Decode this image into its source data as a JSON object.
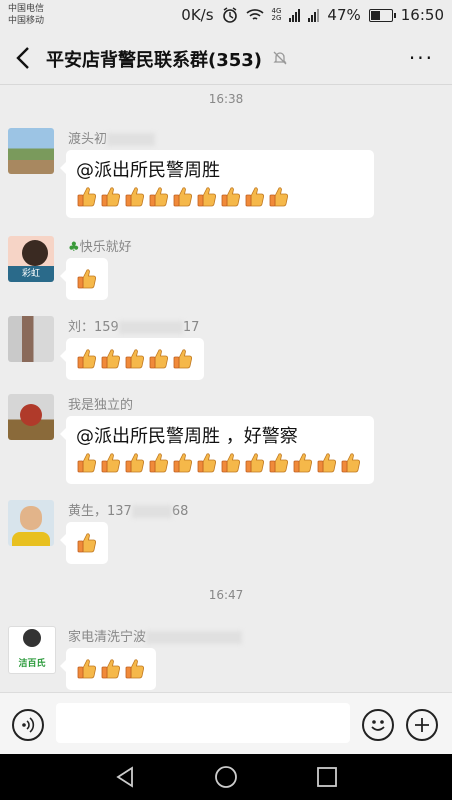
{
  "status": {
    "carrier1": "中国电信",
    "carrier2": "中国移动",
    "speed": "0K/s",
    "net_tag": "4G",
    "net_tag2": "2G",
    "battery": "47%",
    "battery_level": 0.47,
    "time": "16:50"
  },
  "header": {
    "title": "平安店背警民联系群(353)",
    "more": "···"
  },
  "timestamps": [
    "16:38",
    "16:47"
  ],
  "messages": [
    {
      "sender": "渡头初",
      "text": "@派出所民警周胜 ",
      "thumbs": 9
    },
    {
      "sender": "快乐就好",
      "text": "",
      "thumbs": 1
    },
    {
      "sender_prefix": "刘：159",
      "sender_suffix": "17",
      "text": "",
      "thumbs": 5
    },
    {
      "sender": "我是独立的",
      "text": "@派出所民警周胜 ，好警察",
      "thumbs": 12
    },
    {
      "sender_prefix": "黄生，137",
      "sender_suffix": "68",
      "text": "",
      "thumbs": 1
    },
    {
      "sender": "家电清洗宁波",
      "text": "",
      "thumbs": 3
    }
  ],
  "avatars": {
    "avatar2_text": "彩虹",
    "avatar6_text": "洁百氏"
  }
}
